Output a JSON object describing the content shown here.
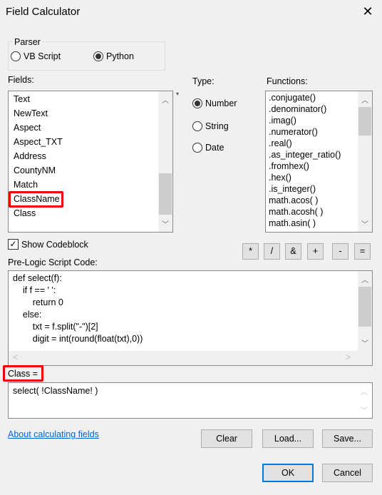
{
  "window": {
    "title": "Field Calculator",
    "close_icon": "close-icon"
  },
  "parser": {
    "label": "Parser",
    "options": [
      {
        "label": "VB Script",
        "selected": false
      },
      {
        "label": "Python",
        "selected": true
      }
    ]
  },
  "fields": {
    "label": "Fields:",
    "items": [
      "Text",
      "NewText",
      "Aspect",
      "Aspect_TXT",
      "Address",
      "CountyNM",
      "Match",
      "ClassName",
      "Class"
    ],
    "highlighted": "ClassName"
  },
  "type": {
    "label": "Type:",
    "options": [
      {
        "label": "Number",
        "selected": true
      },
      {
        "label": "String",
        "selected": false
      },
      {
        "label": "Date",
        "selected": false
      }
    ]
  },
  "functions": {
    "label": "Functions:",
    "items": [
      ".conjugate()",
      ".denominator()",
      ".imag()",
      ".numerator()",
      ".real()",
      ".as_integer_ratio()",
      ".fromhex()",
      ".hex()",
      ".is_integer()",
      "math.acos( )",
      "math.acosh( )",
      "math.asin( )"
    ]
  },
  "codeblock": {
    "label": "Show Codeblock",
    "checked": true
  },
  "operators": [
    "*",
    "/",
    "&",
    "+",
    "-",
    "="
  ],
  "prelogic": {
    "label": "Pre-Logic Script Code:",
    "lines": [
      "def select(f):",
      "    if f == ' ':",
      "        return 0",
      "    else:",
      "        txt = f.split(\"-\")[2]",
      "        digit = int(round(float(txt),0))"
    ]
  },
  "expression": {
    "label": "Class =",
    "value": "select( !ClassName! )"
  },
  "about_link": "About calculating fields",
  "buttons": {
    "clear": "Clear",
    "load": "Load...",
    "save": "Save...",
    "ok": "OK",
    "cancel": "Cancel"
  },
  "colors": {
    "highlight": "#e00000",
    "link": "#0066cc",
    "ok_border": "#0078d7"
  }
}
